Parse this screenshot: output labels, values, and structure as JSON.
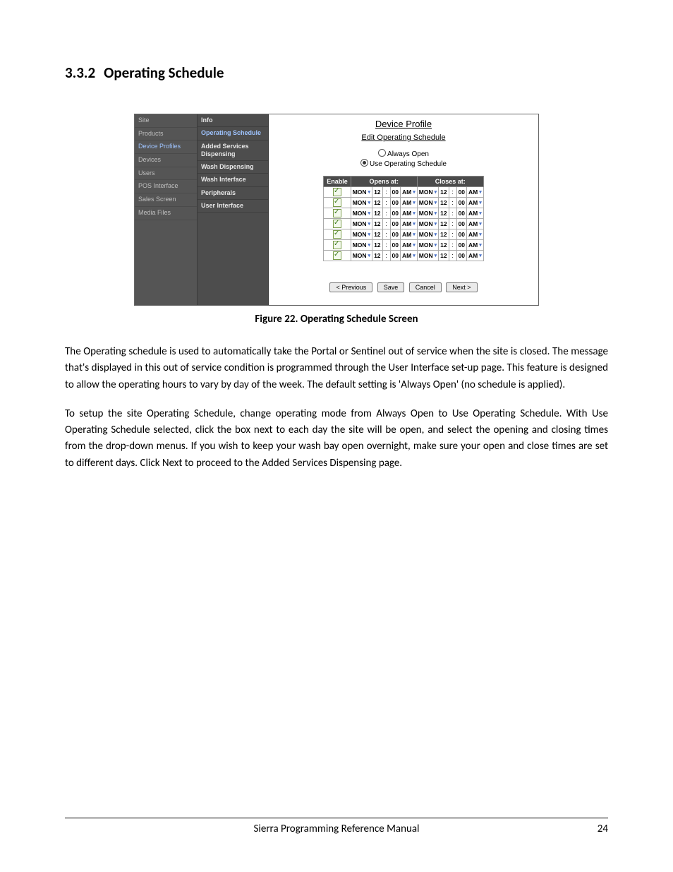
{
  "heading_number": "3.3.2",
  "heading_title": "Operating Schedule",
  "figure_caption": "Figure 22. Operating Schedule Screen",
  "paragraph1": "The Operating schedule is used to automatically take the Portal or Sentinel out of service when the site is closed. The message that's displayed in this out of service condition is programmed through the User Interface set-up page. This feature is designed to allow the operating hours to vary by day of the week. The default setting is 'Always Open' (no schedule is applied).",
  "paragraph2": "To setup the site Operating Schedule, change operating mode from Always Open to Use Operating Schedule. With Use Operating Schedule selected, click the box next to each day the site will be open, and select the opening and closing times from the drop-down menus. If you wish to keep your wash bay open overnight, make sure your open and close times are set to different days. Click Next to proceed to the Added Services Dispensing page.",
  "footer_center": "Sierra Programming Reference Manual",
  "footer_page": "24",
  "nav": {
    "items": [
      {
        "label": "Site",
        "hl": false
      },
      {
        "label": "Products",
        "hl": false
      },
      {
        "label": "Device Profiles",
        "hl": true
      },
      {
        "label": "Devices",
        "hl": false
      },
      {
        "label": "Users",
        "hl": false
      },
      {
        "label": "POS Interface",
        "hl": false
      },
      {
        "label": "Sales Screen",
        "hl": false
      },
      {
        "label": "Media Files",
        "hl": false
      }
    ]
  },
  "subnav": {
    "items": [
      {
        "label": "Info",
        "sel": false
      },
      {
        "label": "Operating Schedule",
        "sel": true
      },
      {
        "label": "Added Services Dispensing",
        "sel": false
      },
      {
        "label": "Wash Dispensing",
        "sel": false
      },
      {
        "label": "Wash Interface",
        "sel": false
      },
      {
        "label": "Peripherals",
        "sel": false
      },
      {
        "label": "User Interface",
        "sel": false
      }
    ]
  },
  "panel": {
    "title": "Device Profile",
    "subtitle": "Edit Operating Schedule",
    "radio_always": "Always Open",
    "radio_use": "Use Operating Schedule",
    "headers": {
      "enable": "Enable",
      "opens": "Opens at:",
      "closes": "Closes at:"
    },
    "rows": [
      {
        "day": "MON",
        "oh": "12",
        "om": "00",
        "oap": "AM",
        "cday": "MON",
        "ch": "12",
        "cm": "00",
        "cap": "AM"
      },
      {
        "day": "MON",
        "oh": "12",
        "om": "00",
        "oap": "AM",
        "cday": "MON",
        "ch": "12",
        "cm": "00",
        "cap": "AM"
      },
      {
        "day": "MON",
        "oh": "12",
        "om": "00",
        "oap": "AM",
        "cday": "MON",
        "ch": "12",
        "cm": "00",
        "cap": "AM"
      },
      {
        "day": "MON",
        "oh": "12",
        "om": "00",
        "oap": "AM",
        "cday": "MON",
        "ch": "12",
        "cm": "00",
        "cap": "AM"
      },
      {
        "day": "MON",
        "oh": "12",
        "om": "00",
        "oap": "AM",
        "cday": "MON",
        "ch": "12",
        "cm": "00",
        "cap": "AM"
      },
      {
        "day": "MON",
        "oh": "12",
        "om": "00",
        "oap": "AM",
        "cday": "MON",
        "ch": "12",
        "cm": "00",
        "cap": "AM"
      },
      {
        "day": "MON",
        "oh": "12",
        "om": "00",
        "oap": "AM",
        "cday": "MON",
        "ch": "12",
        "cm": "00",
        "cap": "AM"
      }
    ],
    "buttons": {
      "prev": "< Previous",
      "save": "Save",
      "cancel": "Cancel",
      "next": "Next >"
    }
  }
}
